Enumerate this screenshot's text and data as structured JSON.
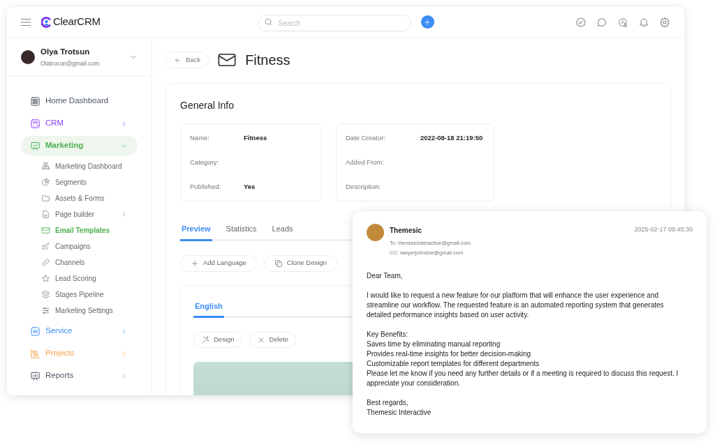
{
  "app": {
    "logo": "ClearCRM",
    "search": {
      "placeholder": "Search"
    }
  },
  "user": {
    "name": "Olya Trotsun",
    "email": "Olatrocun@gmail.com"
  },
  "sidebar": {
    "items": [
      {
        "label": "Home Dashboard",
        "color": "#4b5563",
        "selected": false
      },
      {
        "label": "CRM",
        "color": "#8b3cf7",
        "selected": false,
        "expanded": false
      },
      {
        "label": "Marketing",
        "color": "#4caf50",
        "selected": true,
        "expanded": true,
        "children": [
          {
            "label": "Marketing Dashboard",
            "selected": false
          },
          {
            "label": "Segments",
            "selected": false
          },
          {
            "label": "Assets & Forms",
            "selected": false
          },
          {
            "label": "Page builder",
            "selected": false,
            "expanded": false
          },
          {
            "label": "Email Templates",
            "selected": true
          },
          {
            "label": "Campaigns",
            "selected": false
          },
          {
            "label": "Channels",
            "selected": false
          },
          {
            "label": "Lead Scoring",
            "selected": false
          },
          {
            "label": "Stages Pipeline",
            "selected": false
          },
          {
            "label": "Marketing Settings",
            "selected": false
          }
        ]
      },
      {
        "label": "Service",
        "color": "#3b8cf5",
        "selected": false,
        "expanded": false
      },
      {
        "label": "Projects",
        "color": "#f5a04a",
        "selected": false,
        "expanded": false
      },
      {
        "label": "Reports",
        "color": "#4b5563",
        "selected": false,
        "expanded": false
      }
    ]
  },
  "page": {
    "back": "Back",
    "title": "Fitness",
    "general_info": {
      "title": "General Info",
      "left": [
        {
          "label": "Name:",
          "value": "Fitness"
        },
        {
          "label": "Category:"
        },
        {
          "label": "Published:",
          "value": "Yes"
        }
      ],
      "right": [
        {
          "label": "Date Creator:",
          "value": "2022-08-18 21:19:50"
        },
        {
          "label": "Added From:"
        },
        {
          "label": "Description:"
        }
      ]
    },
    "tabs": [
      {
        "label": "Preview",
        "selected": true
      },
      {
        "label": "Statistics",
        "selected": false
      },
      {
        "label": "Leads",
        "selected": false
      }
    ],
    "actions": [
      "Add Language",
      "Clone Design"
    ],
    "language_tabs": [
      {
        "label": "English",
        "selected": true
      }
    ],
    "design_actions": [
      "Design",
      "Delete"
    ],
    "preview": {
      "kind": "picture"
    }
  },
  "email": {
    "sender": "Themesic",
    "time": "2025-02-17 09:45:30",
    "to": "To: thenesicinteractive@gmail.com",
    "cc": "CC: lawyerjohndoe@gmail.com",
    "paragraphs": [
      [
        "Dear Team,"
      ],
      [
        "I would like to request a new feature for our platform that will enhance the user experience and streamline our workflow. The requested feature is an automated reporting system that generates detailed performance insights based on user activity."
      ],
      [
        "Key Benefits:",
        "Saves time by eliminating manual reporting",
        "Provides real-time insights for better decision-making",
        "Customizable report templates for different departments",
        "Please let me know if you need any further details or if a meeting is required to discuss this request. I appreciate your consideration."
      ],
      [
        "Best regards,",
        "Themesic Interactive"
      ]
    ]
  }
}
